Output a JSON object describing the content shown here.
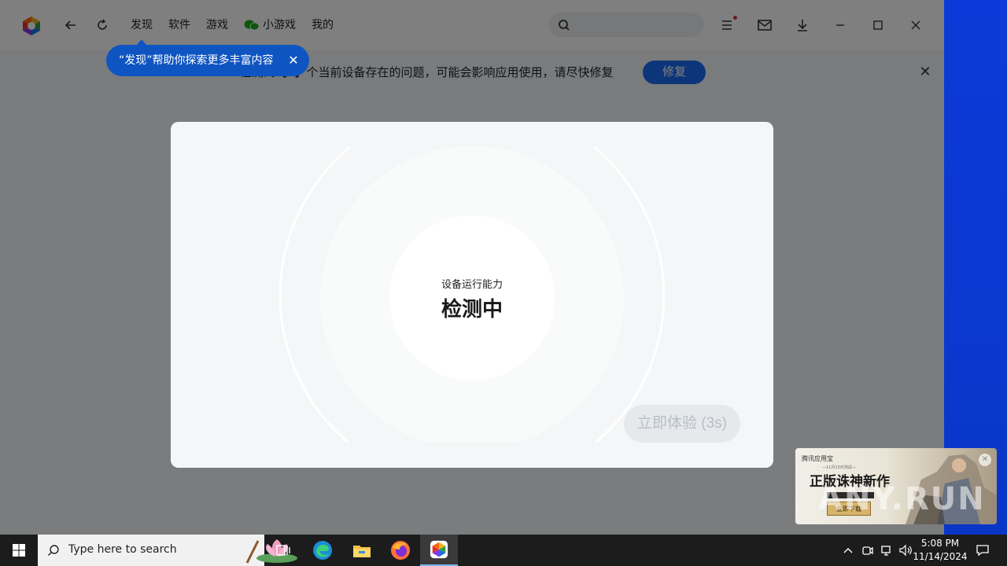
{
  "nav": {
    "tabs": [
      "发现",
      "软件",
      "游戏",
      "小游戏",
      "我的"
    ]
  },
  "search": {
    "placeholder": ""
  },
  "notice": {
    "text": "检测到【2】个当前设备存在的问题，可能会影响应用使用，请尽快修复",
    "fix_label": "修复",
    "close_label": "✕"
  },
  "tooltip": {
    "text": "“发现”帮助你探索更多丰富内容",
    "close_label": "✕"
  },
  "modal": {
    "subtitle": "设备运行能力",
    "status": "检测中",
    "try_button": "立即体验 (3s)"
  },
  "ad": {
    "brand": "腾讯应用宝",
    "subtitle": "—11月15日测试—",
    "title": "正版诛神新作",
    "button": "立即下载",
    "close_label": "✕"
  },
  "watermark": "ANY.RUN",
  "taskbar": {
    "search_placeholder": "Type here to search",
    "time": "5:08 PM",
    "date": "11/14/2024"
  },
  "colors": {
    "accent": "#1a6cf5",
    "tooltip": "#0f55c2",
    "desktop": "#0a3dd6",
    "taskbar": "#1c1c1c"
  }
}
